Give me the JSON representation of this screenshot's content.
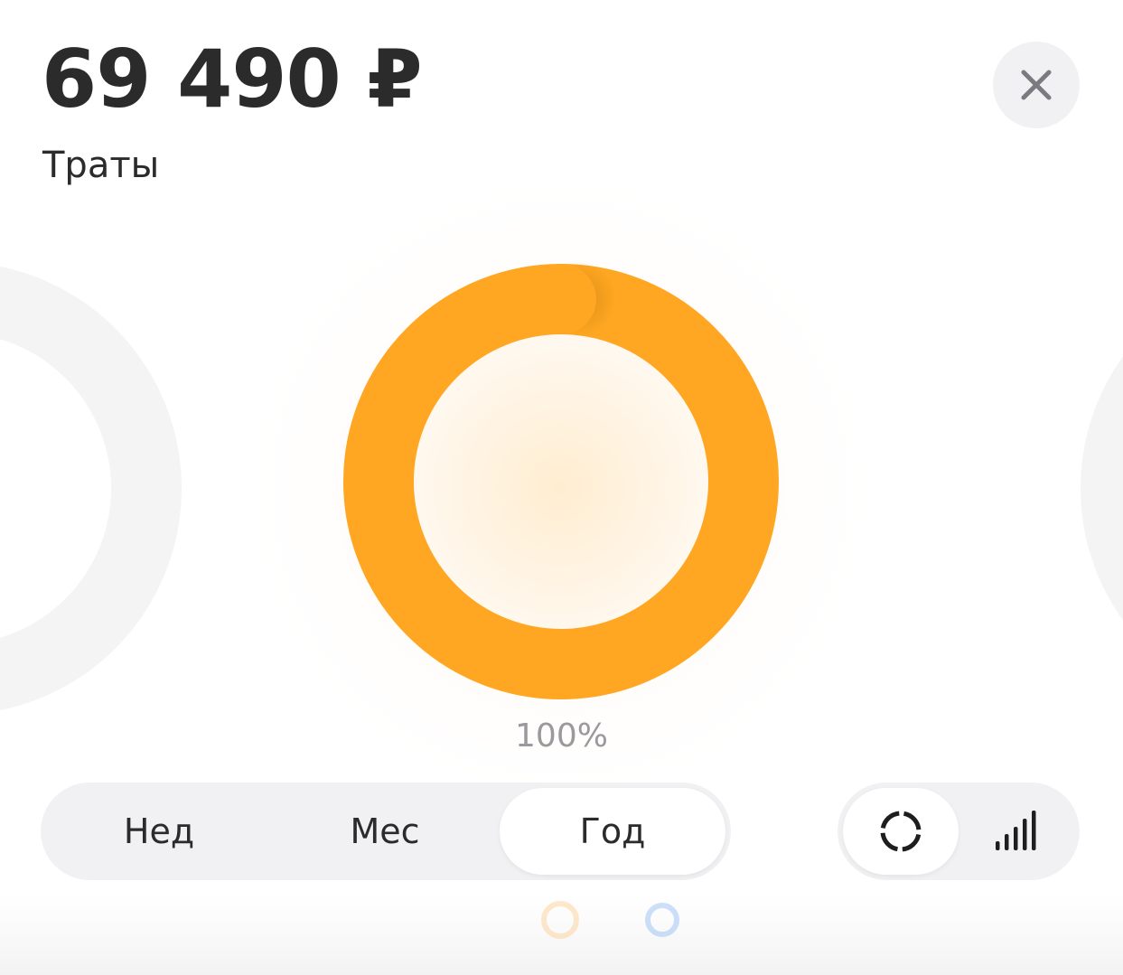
{
  "header": {
    "amount": "69 490 ₽",
    "subtitle": "Траты"
  },
  "close_button": {
    "icon": "close-icon"
  },
  "chart_data": {
    "type": "pie",
    "categories": [
      ""
    ],
    "values": [
      100
    ],
    "data_labels": [
      "100%"
    ],
    "colors": [
      "#FFA722"
    ]
  },
  "period_tabs": {
    "items": [
      "Нед",
      "Мес",
      "Год"
    ],
    "selected": "Год"
  },
  "view_toggle": {
    "items": [
      {
        "icon": "donut-chart-icon",
        "selected": true
      },
      {
        "icon": "bar-chart-icon",
        "selected": false
      }
    ]
  },
  "colors": {
    "accent": "#FFA722",
    "text": "#2B2B2B",
    "muted": "#9A9A9E",
    "segment_bg": "#F1F1F3"
  }
}
